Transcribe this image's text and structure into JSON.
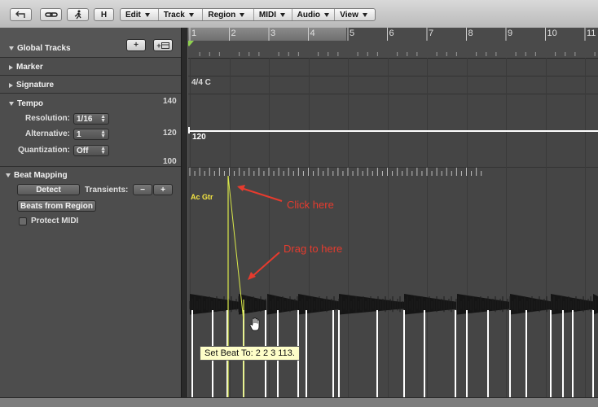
{
  "toolbar": {
    "back_icon": "back-arrow-icon",
    "link_icon": "link-icon",
    "catch_icon": "running-man-icon",
    "h_label": "H",
    "menus": [
      {
        "label": "Edit"
      },
      {
        "label": "Track"
      },
      {
        "label": "Region"
      },
      {
        "label": "MIDI"
      },
      {
        "label": "Audio"
      },
      {
        "label": "View"
      }
    ]
  },
  "global_tracks": {
    "title": "Global Tracks",
    "add_label": "+",
    "add_track_label": "+"
  },
  "marker": {
    "title": "Marker"
  },
  "signature": {
    "title": "Signature",
    "value": "4/4  C"
  },
  "tempo": {
    "title": "Tempo",
    "axis_top": "140",
    "axis_mid": "120",
    "axis_bottom": "100",
    "resolution_label": "Resolution:",
    "resolution_value": "1/16",
    "alternative_label": "Alternative:",
    "alternative_value": "1",
    "quantization_label": "Quantization:",
    "quantization_value": "Off",
    "tempo_value": "120"
  },
  "beat_mapping": {
    "title": "Beat Mapping",
    "detect_label": "Detect",
    "transients_label": "Transients:",
    "minus_label": "−",
    "plus_label": "+",
    "beats_from_region_label": "Beats from Region",
    "protect_midi_label": "Protect MIDI",
    "region_name": "Ac Gtr"
  },
  "ruler": {
    "bars": [
      "1",
      "2",
      "3",
      "4",
      "5",
      "6",
      "7",
      "8",
      "9",
      "10",
      "11"
    ]
  },
  "annotations": {
    "click_here": "Click here",
    "drag_to_here": "Drag to here",
    "arrow_color": "#e63b2e"
  },
  "tooltip": {
    "text": "Set Beat To: 2 2 3 113."
  },
  "colors": {
    "beat_line": "#d9e84a",
    "tempo_line": "#ffffff",
    "region_name": "#f5e642"
  }
}
